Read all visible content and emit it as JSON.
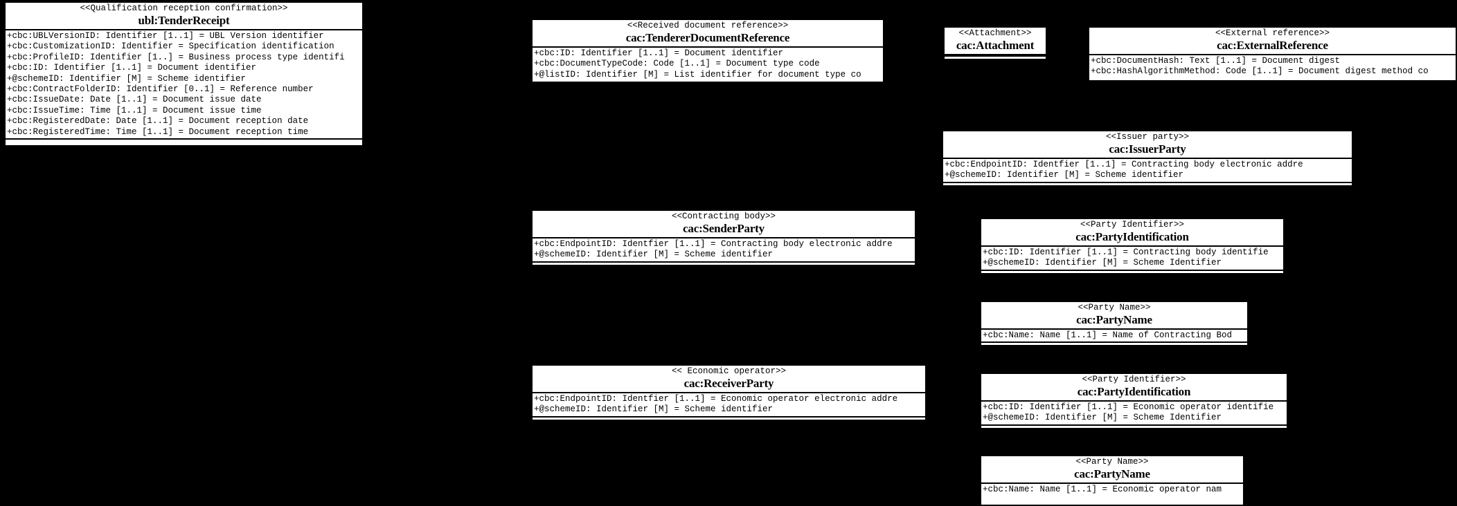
{
  "diagram": {
    "title": "UBL TenderReceipt UML class diagram",
    "background_color": "#000000",
    "box_fill": "#ffffff",
    "line_color": "#000000"
  },
  "classes": [
    {
      "id": "tender-receipt",
      "stereotype": "<<Qualification reception confirmation>>",
      "name": "ubl:TenderReceipt",
      "attributes": [
        "+cbc:UBLVersionID: Identifier [1..1] = UBL Version identifier",
        "+cbc:CustomizationID: Identifier = Specification identification",
        "+cbc:ProfileID: Identifier [1..] = Business process type identifi",
        "+cbc:ID: Identifier [1..1] = Document identifier",
        "+@schemeID: Identifier [M] =  Scheme identifier",
        "+cbc:ContractFolderID: Identifier [0..1] = Reference number",
        "+cbc:IssueDate: Date [1..1] = Document issue date",
        "+cbc:IssueTime: Time [1..1] = Document issue time",
        "+cbc:RegisteredDate: Date [1..1] = Document reception date",
        "+cbc:RegisteredTime: Time [1..1] = Document reception time"
      ],
      "has_footer_strip": true
    },
    {
      "id": "tenderer-document-reference",
      "stereotype": "<<Received document reference>>",
      "name": "cac:TendererDocumentReference",
      "attributes": [
        "+cbc:ID: Identifier [1..1] = Document identifier",
        "+cbc:DocumentTypeCode: Code [1..1] = Document type code",
        "+@listID: Identifier [M] = List identifier for document type co"
      ],
      "has_footer_strip": false
    },
    {
      "id": "attachment",
      "stereotype": "<<Attachment>>",
      "name": "cac:Attachment",
      "attributes": [],
      "has_footer_strip": true
    },
    {
      "id": "external-reference",
      "stereotype": "<<External reference>>",
      "name": "cac:ExternalReference",
      "attributes": [
        "+cbc:DocumentHash: Text [1..1] = Document digest",
        "+cbc:HashAlgorithmMethod: Code [1..1] =  Document digest method co"
      ],
      "has_footer_strip": false
    },
    {
      "id": "issuer-party",
      "stereotype": "<<Issuer party>>",
      "name": "cac:IssuerParty",
      "attributes": [
        "+cbc:EndpointID: Identfier [1..1] = Contracting body electronic addre",
        "+@schemeID: Identifier [M] = Scheme identifier"
      ],
      "has_footer_strip": true
    },
    {
      "id": "sender-party",
      "stereotype": "<<Contracting body>>",
      "name": "cac:SenderParty",
      "attributes": [
        "+cbc:EndpointID: Identfier [1..1] = Contracting body electronic addre",
        "+@schemeID: Identifier [M] = Scheme identifier"
      ],
      "has_footer_strip": true
    },
    {
      "id": "party-identification-contracting-body",
      "stereotype": "<<Party Identifier>>",
      "name": "cac:PartyIdentification",
      "attributes": [
        "+cbc:ID: Identifier [1..1] = Contracting body identifie",
        "+@schemeID: Identifier [M] = Scheme Identifier"
      ],
      "has_footer_strip": true
    },
    {
      "id": "party-name-contracting-body",
      "stereotype": "<<Party Name>>",
      "name": "cac:PartyName",
      "attributes": [
        "+cbc:Name: Name [1..1] = Name of Contracting Bod"
      ],
      "has_footer_strip": true
    },
    {
      "id": "receiver-party",
      "stereotype": "<< Economic operator>>",
      "name": "cac:ReceiverParty",
      "attributes": [
        "+cbc:EndpointID: Identfier [1..1] =  Economic operator electronic addre",
        "+@schemeID: Identifier [M] = Scheme identifier"
      ],
      "has_footer_strip": true
    },
    {
      "id": "party-identification-economic-operator",
      "stereotype": "<<Party Identifier>>",
      "name": "cac:PartyIdentification",
      "attributes": [
        "+cbc:ID: Identifier [1..1] = Economic operator identifie",
        "+@schemeID: Identifier [M] = Scheme Identifier"
      ],
      "has_footer_strip": true
    },
    {
      "id": "party-name-economic-operator",
      "stereotype": "<<Party Name>>",
      "name": "cac:PartyName",
      "attributes": [
        "+cbc:Name: Name [1..1] =  Economic operator nam"
      ],
      "has_footer_strip": false
    }
  ]
}
